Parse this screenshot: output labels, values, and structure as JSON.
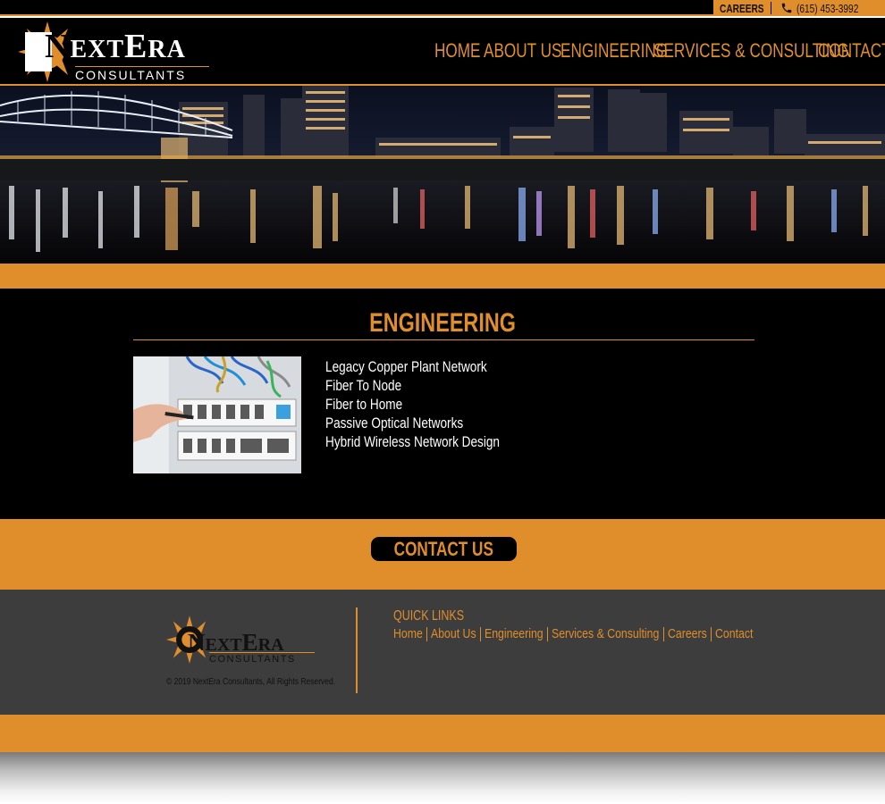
{
  "utility": {
    "careers": "CAREERS",
    "phone": "(615) 453-3992"
  },
  "logo": {
    "brand_first": "N",
    "brand_mid": "EXT",
    "brand_e": "E",
    "brand_end": "RA",
    "sub": "CONSULTANTS"
  },
  "nav": [
    "HOME",
    "ABOUT US",
    "ENGINEERING",
    "SERVICES & CONSULTING",
    "CONTACT"
  ],
  "main": {
    "title": "ENGINEERING",
    "items": [
      "Legacy Copper Plant Network",
      "Fiber To Node",
      "Fiber to Home",
      "Passive Optical Networks",
      "Hybrid Wireless Network Design"
    ]
  },
  "cta": {
    "label": "CONTACT US"
  },
  "footer": {
    "copyright": "© 2019 NextEra Consultants, All Rights Reserved.",
    "quick_links_heading": "QUICK LINKS",
    "quick_links": [
      "Home",
      "About Us",
      "Engineering",
      "Services & Consulting",
      "Careers",
      "Contact"
    ]
  },
  "colors": {
    "accent": "#e08e2b",
    "background": "#000000",
    "footer": "#3d3d3d"
  },
  "icons": {
    "phone": "phone-icon",
    "logo_sun": "sun-logo-icon"
  }
}
